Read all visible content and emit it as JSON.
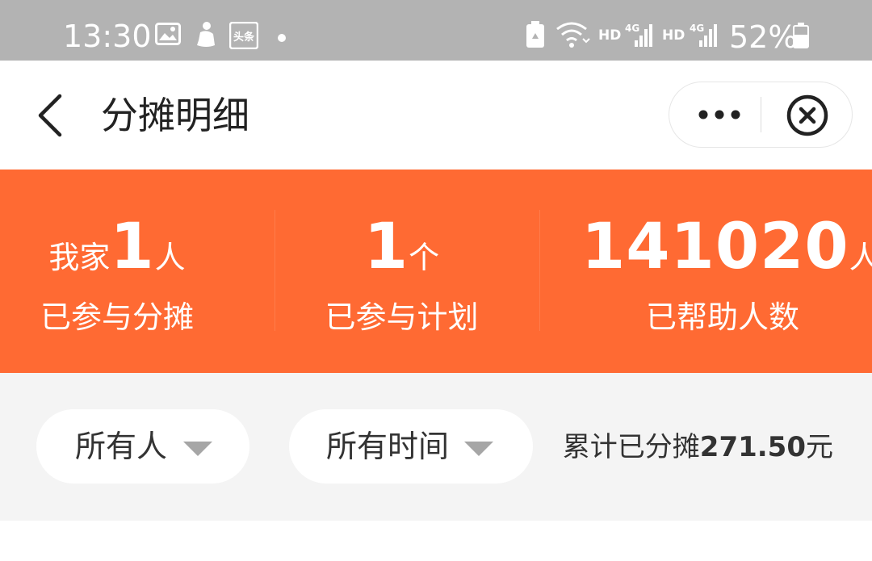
{
  "status_bar": {
    "time": "13:30",
    "hd1": "HD",
    "hd2": "HD",
    "battery": "52%",
    "notification_badge": "头条",
    "icons": [
      "gallery-icon",
      "toutiao-icon",
      "dot-icon",
      "recycle-battery-icon",
      "wifi-icon",
      "signal-4g-icon",
      "battery-icon"
    ]
  },
  "nav": {
    "title": "分摊明细",
    "icons": [
      "back-chevron-icon",
      "more-dots-icon",
      "close-circle-icon"
    ]
  },
  "summary": {
    "family": {
      "prefix": "我家",
      "value": "1",
      "unit": "人",
      "label": "已参与分摊"
    },
    "plans": {
      "value": "1",
      "unit": "个",
      "label": "已参与计划"
    },
    "helped": {
      "value": "141020",
      "unit": "人",
      "label": "已帮助人数"
    }
  },
  "filters": {
    "person": "所有人",
    "time": "所有时间",
    "total_prefix": "累计已分摊",
    "total_amount": "271.50",
    "total_unit": "元"
  },
  "colors": {
    "accent": "#ff6a33",
    "status_bar": "#b3b3b3",
    "background": "#f4f4f4"
  }
}
